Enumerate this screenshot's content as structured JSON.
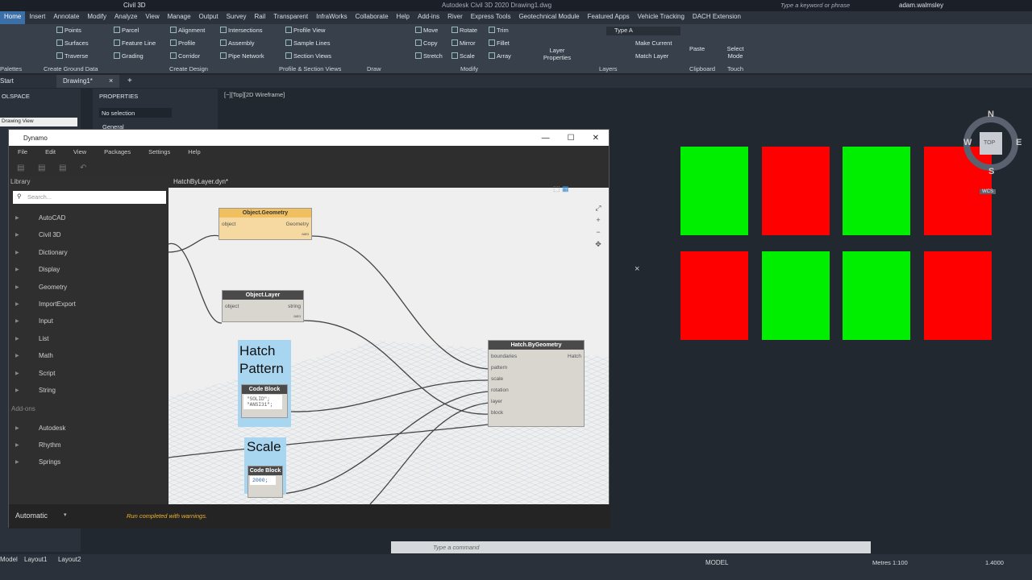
{
  "app": {
    "title": "Autodesk Civil 3D 2020   Drawing1.dwg",
    "workspace": "Civil 3D",
    "search_placeholder": "Type a keyword or phrase",
    "user": "adam.walmsley"
  },
  "menu": [
    "Home",
    "Insert",
    "Annotate",
    "Modify",
    "Analyze",
    "View",
    "Manage",
    "Output",
    "Survey",
    "Rail",
    "Transparent",
    "InfraWorks",
    "Collaborate",
    "Help",
    "Add-ins",
    "River",
    "Express Tools",
    "Geotechnical Module",
    "Featured Apps",
    "Vehicle Tracking",
    "DACH Extension"
  ],
  "ribbon": {
    "create_ground": {
      "points": "Points",
      "surfaces": "Surfaces",
      "traverse": "Traverse",
      "label": "Create Ground Data"
    },
    "create_design": {
      "parcel": "Parcel",
      "feature_line": "Feature Line",
      "grading": "Grading",
      "alignment": "Alignment",
      "profile": "Profile",
      "corridor": "Corridor",
      "intersections": "Intersections",
      "assembly": "Assembly",
      "pipe_network": "Pipe Network",
      "label": "Create Design"
    },
    "profile_section": {
      "profile_view": "Profile View",
      "sample_lines": "Sample Lines",
      "section_views": "Section Views",
      "label": "Profile & Section Views"
    },
    "draw": {
      "label": "Draw"
    },
    "modify": {
      "move": "Move",
      "copy": "Copy",
      "stretch": "Stretch",
      "rotate": "Rotate",
      "mirror": "Mirror",
      "scale": "Scale",
      "trim": "Trim",
      "fillet": "Fillet",
      "array": "Array",
      "label": "Modify"
    },
    "layers": {
      "layer_properties": "Layer Properties",
      "type_a": "Type A",
      "make_current": "Make Current",
      "match_layer": "Match Layer",
      "label": "Layers"
    },
    "clipboard": {
      "paste": "Paste",
      "label": "Clipboard"
    },
    "touch": {
      "select_mode": "Select Mode",
      "label": "Touch"
    },
    "palettes": "Palettes"
  },
  "file_tabs": {
    "start": "Start",
    "drawing": "Drawing1*"
  },
  "viewport_label": "[−][Top][2D Wireframe]",
  "left_panels": {
    "toolspace": "OLSPACE",
    "drawing_view": "Drawing View",
    "properties": "PROPERTIES",
    "no_selection": "No selection",
    "general": "General"
  },
  "compass": {
    "n": "N",
    "s": "S",
    "e": "E",
    "w": "W",
    "top": "TOP",
    "wcs": "WCS"
  },
  "swatches": {
    "green": "#00ee00",
    "red": "#ff0000"
  },
  "dynamo": {
    "title": "Dynamo",
    "menu": [
      "File",
      "Edit",
      "View",
      "Packages",
      "Settings",
      "Help"
    ],
    "library_label": "Library",
    "search_placeholder": "Search...",
    "library": [
      "AutoCAD",
      "Civil 3D",
      "Dictionary",
      "Display",
      "Geometry",
      "ImportExport",
      "Input",
      "List",
      "Math",
      "Script",
      "String"
    ],
    "addons_label": "Add-ons",
    "addons": [
      "Autodesk",
      "Rhythm",
      "Springs"
    ],
    "graph_tab": "HatchByLayer.dyn*",
    "nodes": {
      "object_geometry": {
        "title": "Object.Geometry",
        "in": "object",
        "out": "Geometry",
        "lacing": "auto"
      },
      "object_layer": {
        "title": "Object.Layer",
        "in": "object",
        "out": "string",
        "lacing": "auto"
      },
      "hatch": {
        "title": "Hatch.ByGeometry",
        "inputs": [
          "boundaries",
          "pattern",
          "scale",
          "rotation",
          "layer",
          "block"
        ],
        "out": "Hatch"
      },
      "cb_pattern": {
        "title": "Code Block",
        "code": "\"SOLID\";\n\"ANSI31\";"
      },
      "cb_scale": {
        "title": "Code Block",
        "code": "2000;"
      }
    },
    "groups": {
      "pattern": "Hatch\nPattern",
      "scale": "Scale"
    },
    "run_mode": "Automatic",
    "run_status": "Run completed with warnings."
  },
  "command_placeholder": "Type a command",
  "layouts": [
    "Model",
    "Layout1",
    "Layout2"
  ],
  "status": {
    "model": "MODEL",
    "scale": "Metres 1:100",
    "lineweight": "1.4000"
  }
}
